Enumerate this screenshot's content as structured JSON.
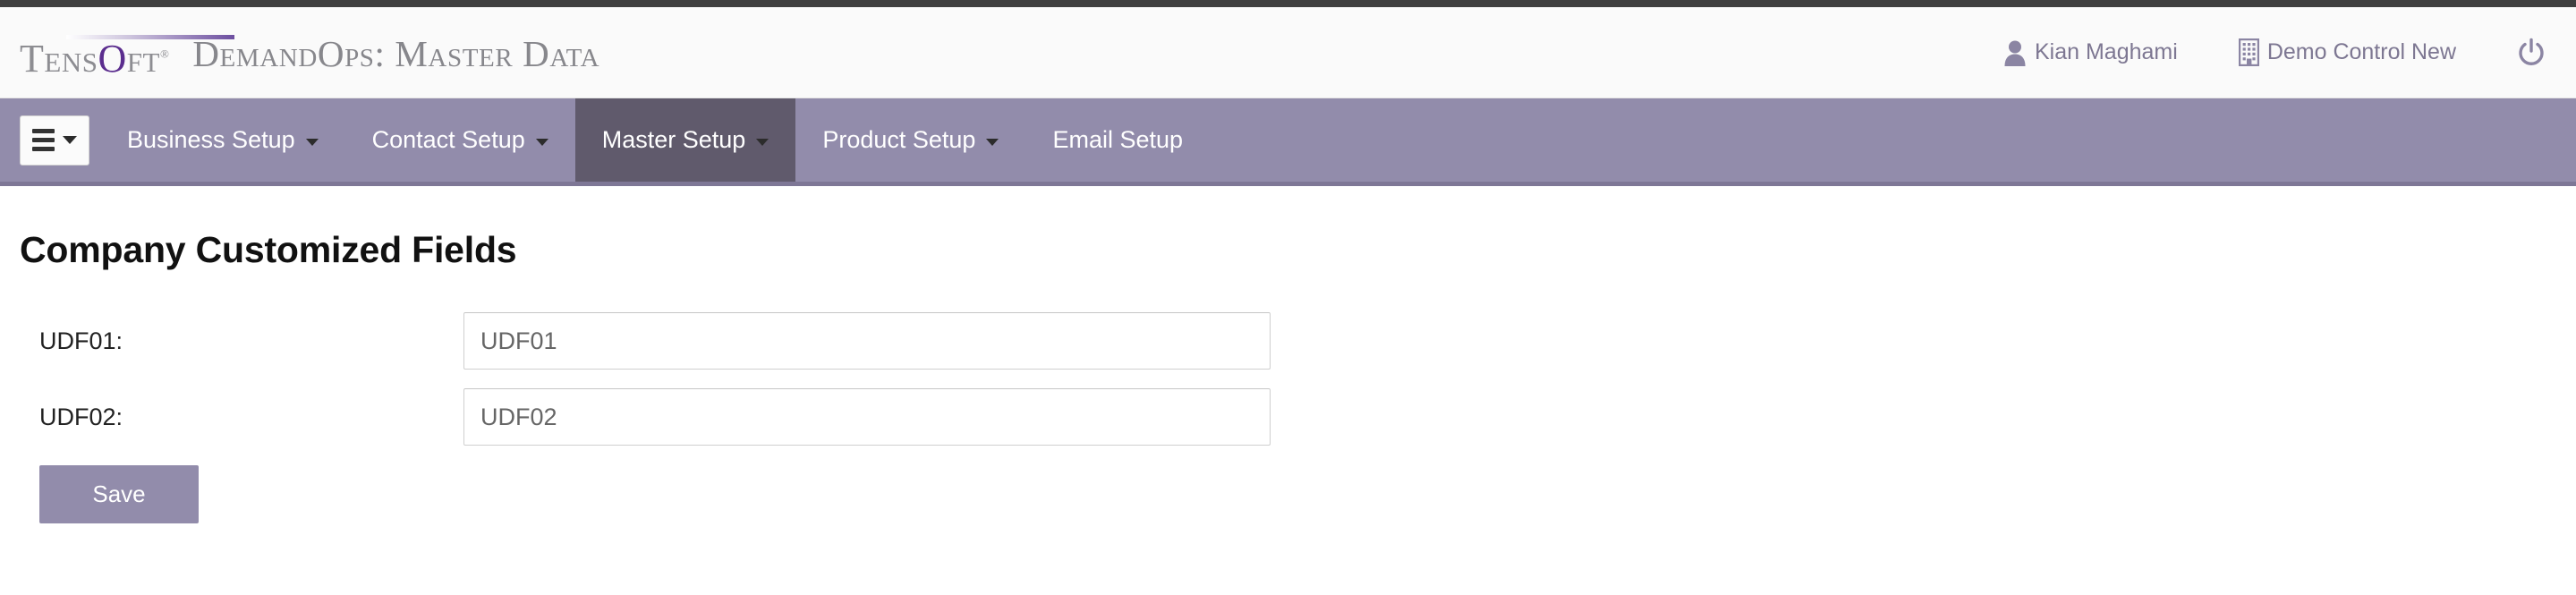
{
  "branding": {
    "logo_text": "Tensoft",
    "logo_o_letter": "O",
    "logo_registered": "®",
    "app_title": "DemandOps: Master Data"
  },
  "header": {
    "user": {
      "icon": "user-icon",
      "label": "Kian Maghami"
    },
    "company": {
      "icon": "building-icon",
      "label": "Demo Control New"
    },
    "logout": {
      "icon": "power-icon",
      "label": ""
    }
  },
  "nav": {
    "toggle": {
      "icon": "hamburger-icon",
      "label": ""
    },
    "items": [
      {
        "label": "Business Setup",
        "has_caret": true,
        "active": false
      },
      {
        "label": "Contact Setup",
        "has_caret": true,
        "active": false
      },
      {
        "label": "Master Setup",
        "has_caret": true,
        "active": true
      },
      {
        "label": "Product Setup",
        "has_caret": true,
        "active": false
      },
      {
        "label": "Email Setup",
        "has_caret": false,
        "active": false
      }
    ]
  },
  "main": {
    "title": "Company Customized Fields",
    "fields": [
      {
        "label": "UDF01:",
        "value": "UDF01",
        "placeholder": "UDF01"
      },
      {
        "label": "UDF02:",
        "value": "UDF02",
        "placeholder": "UDF02"
      }
    ],
    "save_label": "Save"
  },
  "colors": {
    "nav_background": "#928cab",
    "nav_active": "#605a6c",
    "nav_border": "#7e7796",
    "accent_purple": "#5b2d8e",
    "header_text": "#7d7792",
    "top_strip": "#3f3f3f"
  }
}
